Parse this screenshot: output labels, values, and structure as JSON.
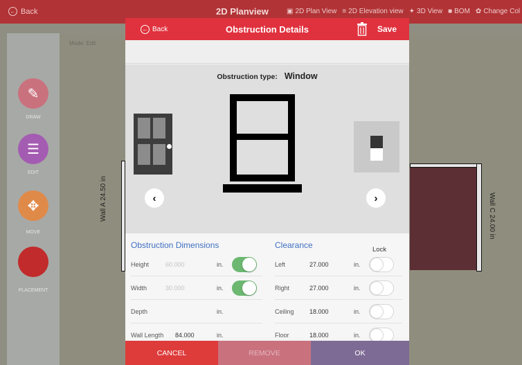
{
  "topbar": {
    "back_label": "Back",
    "title": "2D Planview",
    "nav": [
      {
        "label": "2D Plan View",
        "icon": "plan-icon"
      },
      {
        "label": "2D Elevation view",
        "icon": "list-icon"
      },
      {
        "label": "3D View",
        "icon": "cube-icon"
      },
      {
        "label": "BOM",
        "icon": "document-icon"
      },
      {
        "label": "Change Col",
        "icon": "palette-icon"
      }
    ]
  },
  "sidebar": {
    "tools": [
      {
        "label": "DRAW",
        "color": "#c9727e",
        "icon": "pencil-icon"
      },
      {
        "label": "EDIT",
        "color": "#a45cb2",
        "icon": "ruler-icon"
      },
      {
        "label": "MOVE",
        "color": "#e08a4a",
        "icon": "move-arrows-icon"
      },
      {
        "label": "PLACEMENT",
        "color": "#c12b2b",
        "icon": "placement-icon"
      }
    ]
  },
  "canvas": {
    "mode_label": "Mode: Edit",
    "wall_a_label": "Wall A 24.50 in",
    "wall_c_label": "Wall C 24.00 in"
  },
  "modal": {
    "back_label": "Back",
    "title": "Obstruction Details",
    "save_label": "Save",
    "obstruction_type_label": "Obstruction type:",
    "obstruction_type_value": "Window",
    "options": [
      "door",
      "window",
      "switch"
    ],
    "dimensions_title": "Obstruction Dimensions",
    "clearance_title": "Clearance",
    "lock_title": "Lock",
    "dimensions": [
      {
        "name": "Height",
        "value": "60.000",
        "unit": "in.",
        "locked": true
      },
      {
        "name": "Width",
        "value": "30.000",
        "unit": "in.",
        "locked": true
      },
      {
        "name": "Depth",
        "value": "",
        "unit": "in."
      },
      {
        "name": "Wall Length",
        "value": "84.000",
        "unit": "in."
      }
    ],
    "clearance": [
      {
        "name": "Left",
        "value": "27.000",
        "unit": "in.",
        "locked": false
      },
      {
        "name": "Right",
        "value": "27.000",
        "unit": "in.",
        "locked": false
      },
      {
        "name": "Ceiling",
        "value": "18.000",
        "unit": "in.",
        "locked": false
      },
      {
        "name": "Floor",
        "value": "18.000",
        "unit": "in.",
        "locked": false
      }
    ],
    "footer": {
      "cancel_label": "CANCEL",
      "remove_label": "REMOVE",
      "ok_label": "OK"
    },
    "colors": {
      "header": "#e0323e",
      "link": "#3f6fc2",
      "toggle_on": "#6cb871"
    }
  }
}
